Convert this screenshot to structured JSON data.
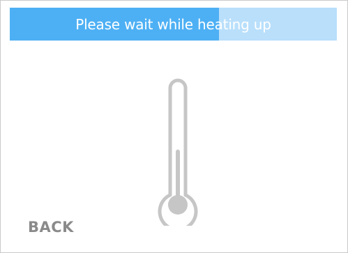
{
  "status": {
    "message": "Please wait while heating up",
    "progress_percent": 64
  },
  "icon": {
    "name": "thermometer-icon",
    "fill_level_percent": 45
  },
  "nav": {
    "back_label": "BACK"
  },
  "colors": {
    "progress_fill": "#4eb0f4",
    "progress_track": "#b9dffb",
    "icon": "#c6c6c6",
    "back_text": "#8a8a8a"
  }
}
